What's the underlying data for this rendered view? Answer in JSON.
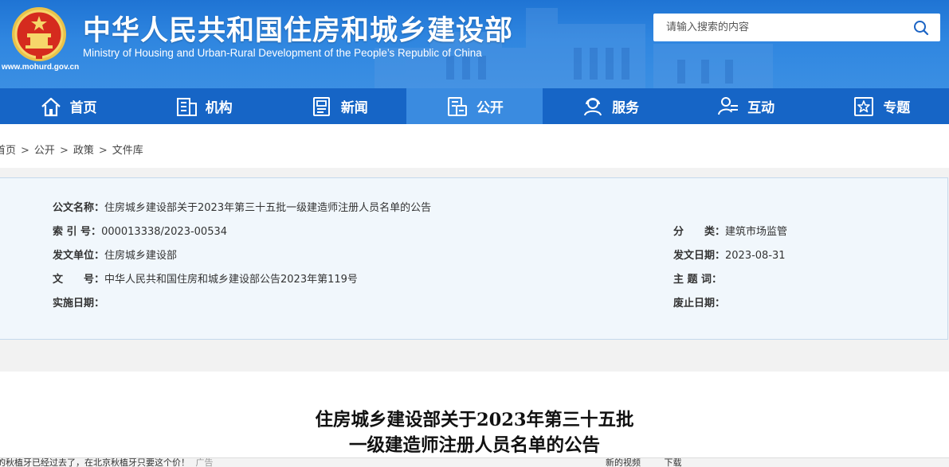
{
  "header": {
    "title": "中华人民共和国住房和城乡建设部",
    "subtitle": "Ministry of Housing and Urban-Rural Development of the People’s Republic of China",
    "url": "www.mohurd.gov.cn",
    "emblem_icon": "national-emblem-icon"
  },
  "search": {
    "placeholder": "请输入搜索的内容",
    "icon": "search-icon"
  },
  "nav": {
    "items": [
      {
        "label": "首页",
        "icon": "home-icon"
      },
      {
        "label": "机构",
        "icon": "building-icon"
      },
      {
        "label": "新闻",
        "icon": "news-icon"
      },
      {
        "label": "公开",
        "icon": "document-icon"
      },
      {
        "label": "服务",
        "icon": "service-person-icon"
      },
      {
        "label": "互动",
        "icon": "interaction-icon"
      },
      {
        "label": "专题",
        "icon": "star-topic-icon"
      }
    ],
    "active_index": 3
  },
  "breadcrumb": {
    "items": [
      "首页",
      "公开",
      "政策",
      "文件库"
    ],
    "separator": ">"
  },
  "meta": {
    "title_key": "公文名称：",
    "title_value": "住房城乡建设部关于2023年第三十五批一级建造师注册人员名单的公告",
    "index_key": "索 引 号：",
    "index_value": "000013338/2023-00534",
    "category_key": "分　　类：",
    "category_value": "建筑市场监管",
    "issuer_key": "发文单位：",
    "issuer_value": "住房城乡建设部",
    "date_key": "发文日期：",
    "date_value": "2023-08-31",
    "docno_key": "文　　号：",
    "docno_value": "中华人民共和国住房和城乡建设部公告2023年第119号",
    "keywords_key": "主 题 词：",
    "keywords_value": "",
    "effective_key": "实施日期：",
    "effective_value": "",
    "expiry_key": "废止日期：",
    "expiry_value": ""
  },
  "article": {
    "title_line1": "住房城乡建设部关于2023年第三十五批",
    "title_line2": "一级建造师注册人员名单的公告"
  },
  "bottom_bar": {
    "news_text": "的秋植牙已经过去了，在北京秋植牙只要这个价！",
    "news_tag": "广告",
    "tools": [
      "新的视频",
      "下载"
    ]
  },
  "colors": {
    "header_blue": "#2f86e0",
    "nav_blue": "#1665c6",
    "nav_active": "#3a8be0",
    "meta_bg": "#f1f7fc"
  }
}
